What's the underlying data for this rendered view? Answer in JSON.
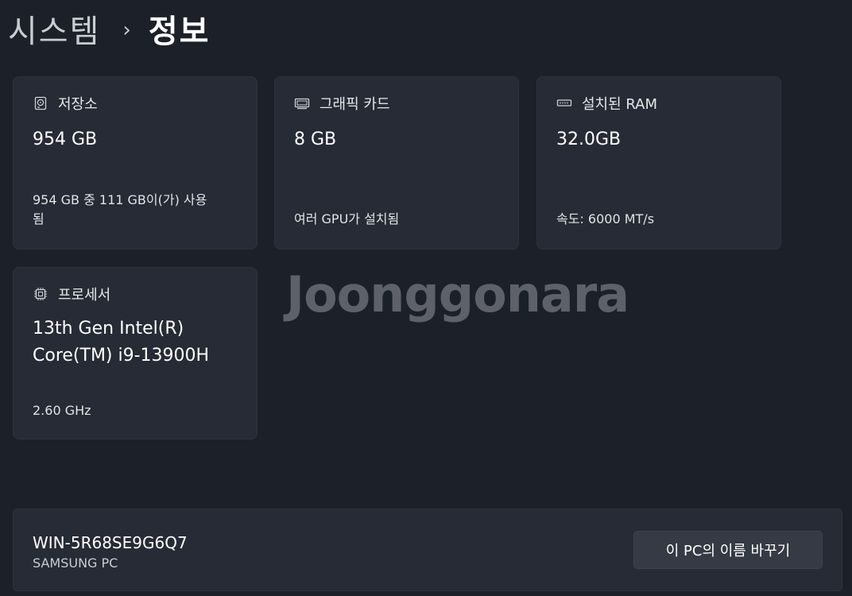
{
  "breadcrumb": {
    "parent": "시스템",
    "separator": "›",
    "current": "정보"
  },
  "cards": {
    "storage": {
      "icon": "hard-drive-icon",
      "title": "저장소",
      "value": "954 GB",
      "sub_line1": "954 GB 중 111 GB이(가) 사용",
      "sub_line2": "됨"
    },
    "graphics": {
      "icon": "graphics-card-icon",
      "title": "그래픽 카드",
      "value": "8 GB",
      "sub": "여러 GPU가 설치됨"
    },
    "ram": {
      "icon": "memory-icon",
      "title": "설치된 RAM",
      "value": "32.0GB",
      "sub": "속도: 6000 MT/s"
    },
    "processor": {
      "icon": "processor-icon",
      "title": "프로세서",
      "value_line1": "13th Gen Intel(R)",
      "value_line2": "Core(TM) i9-13900H",
      "sub": "2.60 GHz"
    }
  },
  "watermark": "Joonggonara",
  "device": {
    "name": "WIN-5R68SE9G6Q7",
    "model": "SAMSUNG PC",
    "rename_label": "이 PC의 이름 바꾸기"
  },
  "colors": {
    "background": "#1c2029",
    "card": "#262b35",
    "button": "#353a44"
  }
}
